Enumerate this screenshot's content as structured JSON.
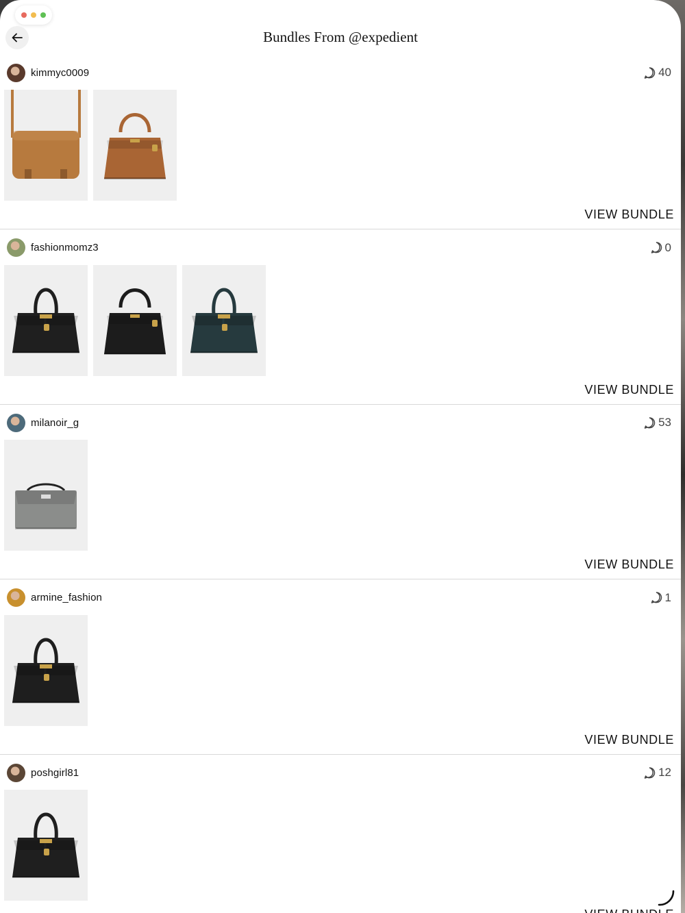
{
  "window": {
    "title": "Bundles From @expedient",
    "traffic_colors": [
      "#e76a5e",
      "#f2bd4f",
      "#5fc054"
    ]
  },
  "bundles": [
    {
      "username": "kimmyc0009",
      "comments": "40",
      "avatar_color": "#5a3a2c",
      "view_label": "VIEW BUNDLE",
      "items": [
        {
          "kind": "shoulder",
          "color": "#b77a3e"
        },
        {
          "kind": "kelly",
          "color": "#a96534"
        }
      ]
    },
    {
      "username": "fashionmomz3",
      "comments": "0",
      "avatar_color": "#8a9a6a",
      "view_label": "VIEW BUNDLE",
      "items": [
        {
          "kind": "birkin",
          "color": "#1f1f1f"
        },
        {
          "kind": "kelly",
          "color": "#1c1c1c"
        },
        {
          "kind": "birkin",
          "color": "#263a3e"
        }
      ]
    },
    {
      "username": "milanoir_g",
      "comments": "53",
      "avatar_color": "#4d6a7a",
      "view_label": "VIEW BUNDLE",
      "items": [
        {
          "kind": "pochette",
          "color": "#8b8d8b"
        }
      ]
    },
    {
      "username": "armine_fashion",
      "comments": "1",
      "avatar_color": "#c8902e",
      "view_label": "VIEW BUNDLE",
      "items": [
        {
          "kind": "birkin",
          "color": "#1e1e1e"
        }
      ]
    },
    {
      "username": "poshgirl81",
      "comments": "12",
      "avatar_color": "#5b4636",
      "view_label": "VIEW BUNDLE",
      "items": [
        {
          "kind": "birkin",
          "color": "#1f1f1f"
        }
      ]
    }
  ]
}
